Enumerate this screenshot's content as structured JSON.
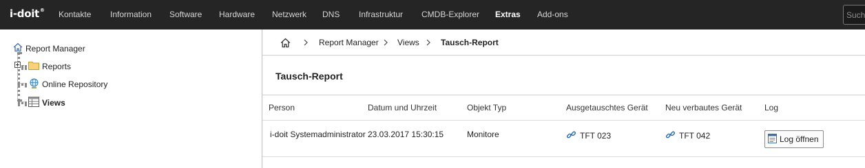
{
  "topbar": {
    "logo": "i-doit",
    "logo_sup": "®",
    "nav": [
      "Kontakte",
      "Information",
      "Software",
      "Hardware",
      "Netzwerk",
      "DNS",
      "Infrastruktur",
      "CMDB-Explorer",
      "Extras",
      "Add-ons"
    ],
    "active": "Extras",
    "search_placeholder": "Suche"
  },
  "tree": {
    "root": "Report Manager",
    "items": [
      "Reports",
      "Online Repository",
      "Views"
    ],
    "selected": "Views"
  },
  "breadcrumb": [
    "Report Manager",
    "Views",
    "Tausch-Report"
  ],
  "page_title": "Tausch-Report",
  "table": {
    "columns": [
      "Person",
      "Datum und Uhrzeit",
      "Objekt Typ",
      "Ausgetauschtes Gerät",
      "Neu verbautes Gerät",
      "Log"
    ],
    "rows": [
      {
        "person": "i-doit Systemadministrator",
        "datetime": "23.03.2017 15:30:15",
        "object_type": "Monitore",
        "replaced": "TFT 023",
        "new": "TFT 042",
        "log_button": "Log öffnen"
      }
    ]
  },
  "colors": {
    "topbar_bg": "#252525",
    "folder": "#f5c542",
    "link_icon": "#2b6cb0"
  }
}
